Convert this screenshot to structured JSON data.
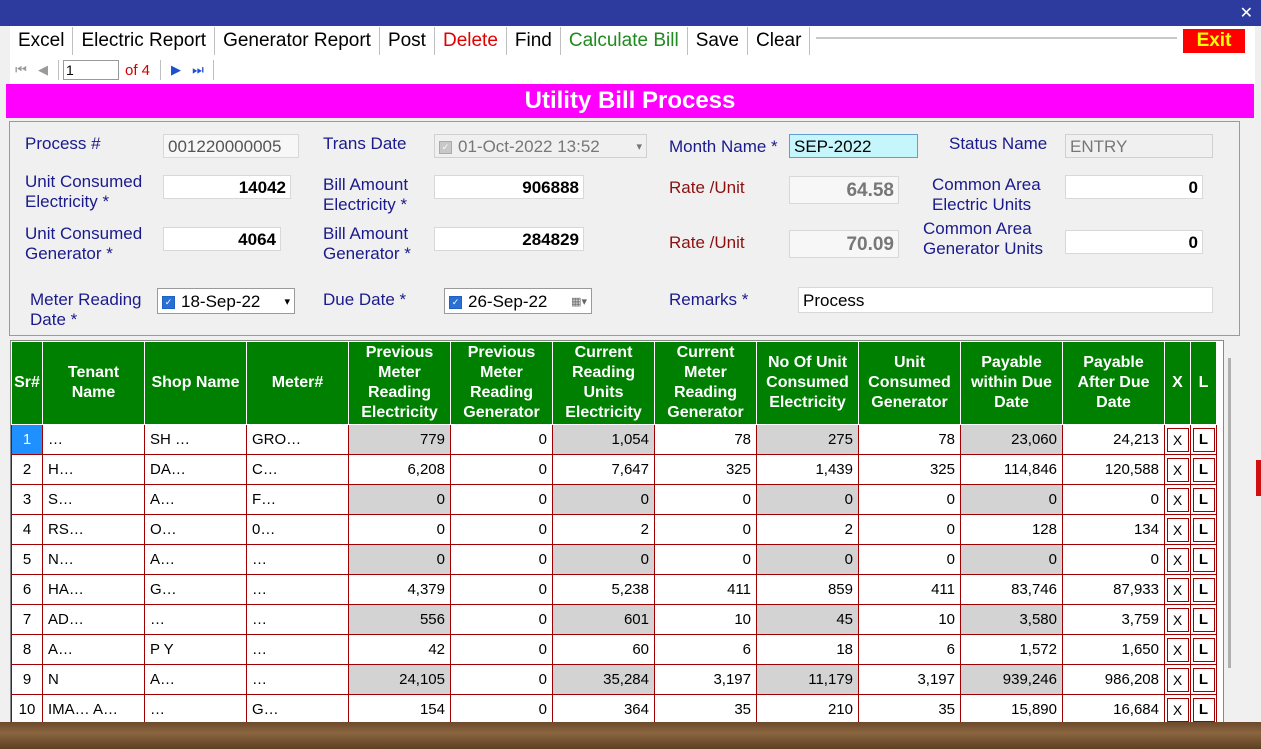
{
  "menu": {
    "items": [
      "Excel",
      "Electric Report",
      "Generator Report",
      "Post",
      "Delete",
      "Find",
      "Calculate Bill",
      "Save",
      "Clear"
    ],
    "exit": "Exit"
  },
  "nav": {
    "page_value": "1",
    "of_label": "of 4"
  },
  "heading": "Utility Bill Process",
  "form": {
    "process_no_label": "Process #",
    "process_no": "001220000005",
    "trans_date_label": "Trans Date",
    "trans_date": "01-Oct-2022 13:52",
    "month_label": "Month Name *",
    "month_value": "SEP-2022",
    "status_label": "Status Name",
    "status_value": "ENTRY",
    "unit_elec_label1": "Unit Consumed",
    "unit_elec_label2": "Electricity *",
    "unit_elec_value": "14042",
    "bill_elec_label1": "Bill Amount",
    "bill_elec_label2": "Electricity *",
    "bill_elec_value": "906888",
    "rate_label": "Rate /Unit",
    "rate_elec_value": "64.58",
    "ca_elec_label1": "Common Area",
    "ca_elec_label2": "Electric Units",
    "ca_elec_value": "0",
    "unit_gen_label1": "Unit Consumed",
    "unit_gen_label2": "Generator *",
    "unit_gen_value": "4064",
    "bill_gen_label1": "Bill Amount",
    "bill_gen_label2": "Generator *",
    "bill_gen_value": "284829",
    "rate_gen_value": "70.09",
    "ca_gen_label1": "Common Area",
    "ca_gen_label2": "Generator Units",
    "ca_gen_value": "0",
    "meter_date_label1": "Meter Reading",
    "meter_date_label2": "Date *",
    "meter_date": "18-Sep-22",
    "due_date_label": "Due Date *",
    "due_date": "26-Sep-22",
    "remarks_label": "Remarks *",
    "remarks_value": "Process"
  },
  "grid": {
    "headers": {
      "sr": "Sr#",
      "tenant": "Tenant Name",
      "shop": "Shop Name",
      "meter": "Meter#",
      "prev_elec": "Previous Meter Reading Electricity",
      "prev_gen": "Previous Meter Reading Generator",
      "cur_elec": "Current Reading Units Electricity",
      "cur_gen": "Current Meter Reading Generator",
      "units_elec": "No Of Unit Consumed Electricity",
      "units_gen": "Unit Consumed Generator",
      "pay_within": "Payable within Due Date",
      "pay_after": "Payable After Due Date",
      "x": "X",
      "l": "L"
    },
    "rows": [
      {
        "sr": "1",
        "tenant": "…",
        "shop": "SH …",
        "meter": "GRO…",
        "prev_elec": "779",
        "prev_gen": "0",
        "cur_elec": "1,054",
        "cur_gen": "78",
        "units_elec": "275",
        "units_gen": "78",
        "pay_within": "23,060",
        "pay_after": "24,213"
      },
      {
        "sr": "2",
        "tenant": "H…",
        "shop": "DA…",
        "meter": "C…",
        "prev_elec": "6,208",
        "prev_gen": "0",
        "cur_elec": "7,647",
        "cur_gen": "325",
        "units_elec": "1,439",
        "units_gen": "325",
        "pay_within": "114,846",
        "pay_after": "120,588"
      },
      {
        "sr": "3",
        "tenant": "S…",
        "shop": "A…",
        "meter": "F…",
        "prev_elec": "0",
        "prev_gen": "0",
        "cur_elec": "0",
        "cur_gen": "0",
        "units_elec": "0",
        "units_gen": "0",
        "pay_within": "0",
        "pay_after": "0"
      },
      {
        "sr": "4",
        "tenant": "RS…",
        "shop": "O…",
        "meter": "0…",
        "prev_elec": "0",
        "prev_gen": "0",
        "cur_elec": "2",
        "cur_gen": "0",
        "units_elec": "2",
        "units_gen": "0",
        "pay_within": "128",
        "pay_after": "134"
      },
      {
        "sr": "5",
        "tenant": "N…",
        "shop": "A…",
        "meter": "…",
        "prev_elec": "0",
        "prev_gen": "0",
        "cur_elec": "0",
        "cur_gen": "0",
        "units_elec": "0",
        "units_gen": "0",
        "pay_within": "0",
        "pay_after": "0"
      },
      {
        "sr": "6",
        "tenant": "HA…",
        "shop": "G…",
        "meter": "…",
        "prev_elec": "4,379",
        "prev_gen": "0",
        "cur_elec": "5,238",
        "cur_gen": "411",
        "units_elec": "859",
        "units_gen": "411",
        "pay_within": "83,746",
        "pay_after": "87,933"
      },
      {
        "sr": "7",
        "tenant": "AD…",
        "shop": "…",
        "meter": "…",
        "prev_elec": "556",
        "prev_gen": "0",
        "cur_elec": "601",
        "cur_gen": "10",
        "units_elec": "45",
        "units_gen": "10",
        "pay_within": "3,580",
        "pay_after": "3,759"
      },
      {
        "sr": "8",
        "tenant": "A…",
        "shop": "P Y",
        "meter": "…",
        "prev_elec": "42",
        "prev_gen": "0",
        "cur_elec": "60",
        "cur_gen": "6",
        "units_elec": "18",
        "units_gen": "6",
        "pay_within": "1,572",
        "pay_after": "1,650"
      },
      {
        "sr": "9",
        "tenant": "N",
        "shop": "A…",
        "meter": "…",
        "prev_elec": "24,105",
        "prev_gen": "0",
        "cur_elec": "35,284",
        "cur_gen": "3,197",
        "units_elec": "11,179",
        "units_gen": "3,197",
        "pay_within": "939,246",
        "pay_after": "986,208"
      },
      {
        "sr": "10",
        "tenant": "IMA… A…",
        "shop": "…",
        "meter": "G…",
        "prev_elec": "154",
        "prev_gen": "0",
        "cur_elec": "364",
        "cur_gen": "35",
        "units_elec": "210",
        "units_gen": "35",
        "pay_within": "15,890",
        "pay_after": "16,684"
      }
    ],
    "x_label": "X",
    "l_label": "L"
  },
  "colors": {
    "titlebar": "#2e3b9e",
    "heading": "#ff00ff",
    "grid_header": "#008000",
    "selected": "#1e90ff",
    "exit": "#ff0000"
  }
}
